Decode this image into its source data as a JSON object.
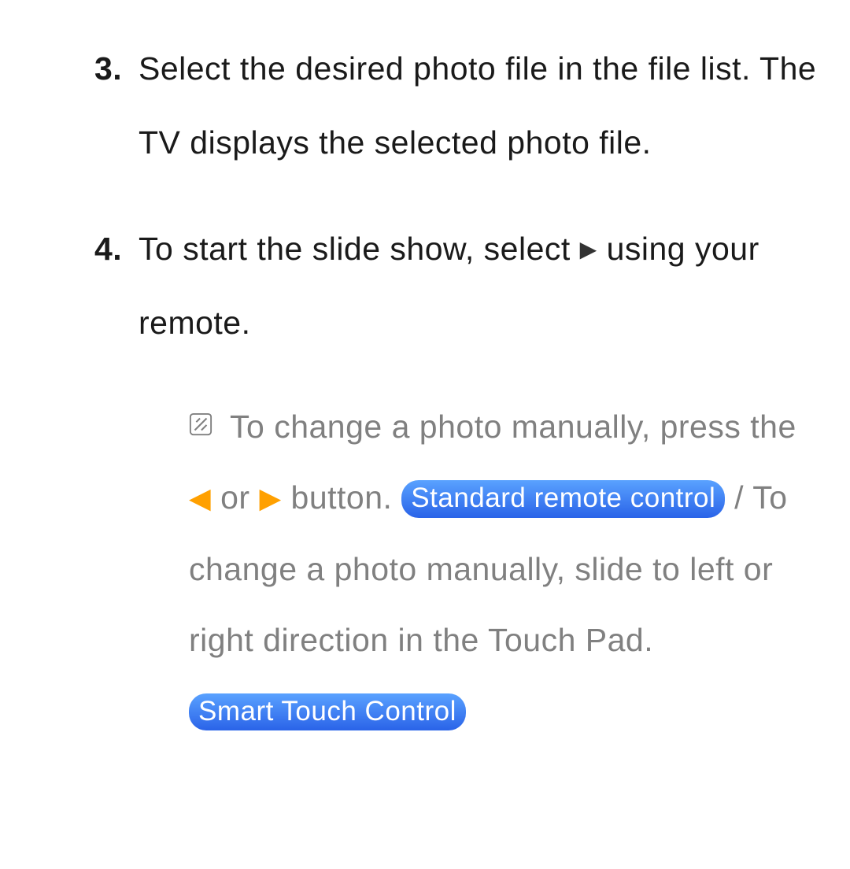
{
  "steps": {
    "s3": {
      "num": "3.",
      "text": "Select the desired photo file in the file list. The TV displays the selected photo file."
    },
    "s4": {
      "num": "4.",
      "text_a": "To start the slide show, select ",
      "text_b": " using your remote."
    }
  },
  "note": {
    "part1": "To change a photo manually, press the ",
    "part_or": " or ",
    "part2": " button. ",
    "pill1": "Standard remote control",
    "part3": " / To change a photo manually, slide to left or right direction in the Touch Pad. ",
    "pill2": "Smart Touch Control"
  },
  "glyphs": {
    "play": "∂",
    "left": "l",
    "right": "r"
  }
}
